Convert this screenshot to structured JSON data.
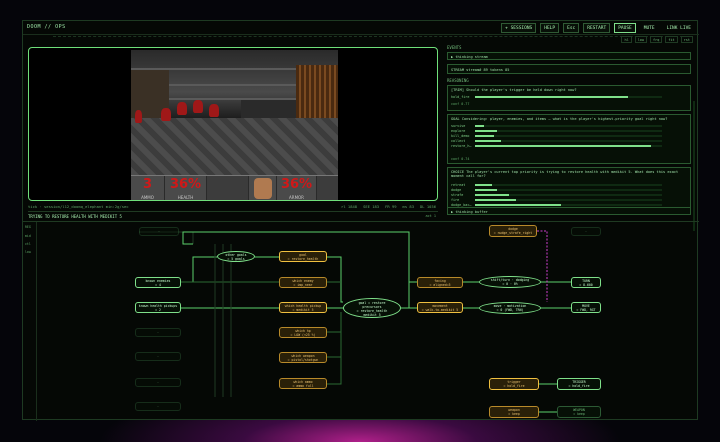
{
  "app": {
    "title": "DOOM // OPS",
    "buttons": [
      "+ SESSIONS",
      "HELP",
      "Esc",
      "RESTART",
      "PAUSE",
      "MUTE",
      "LINK LIVE"
    ],
    "mini_buttons": [
      "hl",
      "low",
      "frq",
      "fit",
      "rst"
    ]
  },
  "game_hud": {
    "ammo": "3",
    "health": "36%",
    "armor": "36%",
    "ammo_label": "AMMO",
    "health_label": "HEALTH",
    "armor_label": "ARMOR"
  },
  "video_status": {
    "left": "tick · session/l12_doomq_elephant min:2g/sec",
    "right": [
      "rl 1848",
      "SEE 183",
      "FR 99",
      "ms 83",
      "DL 1036"
    ]
  },
  "activity": {
    "text": "TRYING TO RESTORE HEALTH WITH MEDIKIT 5",
    "right": "act 1"
  },
  "sidebar": {
    "section_title": "EVENTS",
    "status_line": "▶ thinking stream",
    "stream_line": "STREAM  stream#  89  tokens  85",
    "reasoning_title": "REASONING",
    "cards": [
      {
        "text": "[TRIM] Should the player's trigger be held down right now?",
        "bars": [
          {
            "label": "hold_fire",
            "value": 0.82
          }
        ],
        "foot": "conf 0.77"
      },
      {
        "text": "GOAL Considering: player, enemies, and items — what is the player's highest-priority goal right now?",
        "bars": [
          {
            "label": "survive",
            "value": 0.05
          },
          {
            "label": "explore",
            "value": 0.12
          },
          {
            "label": "kill_demo",
            "value": 0.1
          },
          {
            "label": "collect",
            "value": 0.14
          },
          {
            "label": "restore_h…",
            "value": 0.94
          }
        ],
        "foot": "conf 0.74"
      },
      {
        "text": "CHOICE The player's current top priority is trying to restore health with medikit 5. What does this exact moment call for?",
        "bars": [
          {
            "label": "retreat",
            "value": 0.09
          },
          {
            "label": "dodge",
            "value": 0.12
          },
          {
            "label": "strafe",
            "value": 0.18
          },
          {
            "label": "fire",
            "value": 0.22
          },
          {
            "label": "dodge_bac…",
            "value": 0.46
          }
        ],
        "foot": ""
      }
    ],
    "footer": "▶ thinking buffer"
  },
  "graph": {
    "rail": [
      "REG",
      "mid",
      "ctl",
      "low"
    ],
    "nodes": [
      {
        "key": "n1",
        "label": "—",
        "x": 0,
        "y": 0
      },
      {
        "key": "enemy_present",
        "label": "known enemies\n= 4"
      },
      {
        "key": "known_health",
        "label": "known health pickups\n= 2"
      },
      {
        "key": "other_goals",
        "label": "other goals\n= 5 goals"
      },
      {
        "key": "goal_restore",
        "label": "goal\n= restore_health"
      },
      {
        "key": "which_enemy",
        "label": "which enemy\n= imp_near"
      },
      {
        "key": "which_pickup",
        "label": "which health pickup\n= medikit 5"
      },
      {
        "key": "which_hp",
        "label": "which hp\n= LOW (<25 %)"
      },
      {
        "key": "which_weapon",
        "label": "which weapon\n= pistol/shotgun"
      },
      {
        "key": "which_ammo",
        "label": "which ammo\n= ammo full"
      },
      {
        "key": "goal_hub",
        "label": "goal = restore\nprecursors\n= restore_health\nmedikit 5"
      },
      {
        "key": "facing",
        "label": "facing\n= aligned=5"
      },
      {
        "key": "movement",
        "label": "movement\n= walk-to-medikit 5"
      },
      {
        "key": "shift_dodge",
        "label": "shift/turn · dodging\n= 0 · 0%"
      },
      {
        "key": "move_motivation",
        "label": "move · motivation\n= 0 (FWD, TRN)"
      },
      {
        "key": "turn_out",
        "label": "TURN\n= 8.600"
      },
      {
        "key": "move_out",
        "label": "MOVE\n= FWD, RGT"
      },
      {
        "key": "dodge_top",
        "label": "dodge\n= nudge_strafe_right"
      },
      {
        "key": "trigger",
        "label": "trigger\n= hold_fire"
      },
      {
        "key": "trigger_out",
        "label": "TRIGGER\n= hold_fire"
      },
      {
        "key": "weapon",
        "label": "weapon\n= keep"
      },
      {
        "key": "weapon_out",
        "label": "WEAPON\n= keep"
      },
      {
        "key": "ghost1",
        "label": "—"
      },
      {
        "key": "ghost2",
        "label": "—"
      },
      {
        "key": "ghost3",
        "label": "—"
      },
      {
        "key": "ghost4",
        "label": "—"
      },
      {
        "key": "ghost5",
        "label": "—"
      },
      {
        "key": "ghost6",
        "label": "—"
      }
    ]
  }
}
